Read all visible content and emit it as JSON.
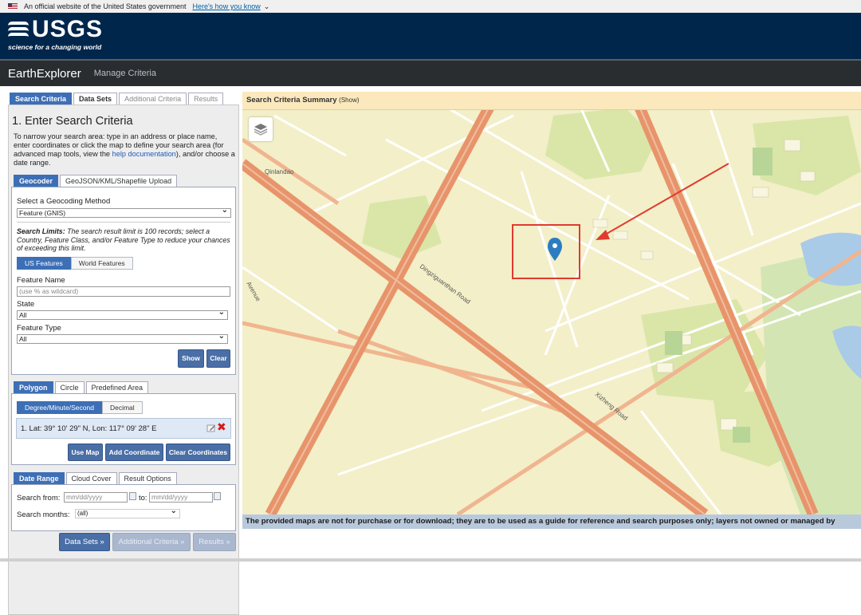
{
  "gov_banner": {
    "text": "An official website of the United States government",
    "link": "Here's how you know"
  },
  "usgs": {
    "word": "USGS",
    "tagline": "science for a changing world"
  },
  "nav": {
    "brand": "EarthExplorer",
    "manage": "Manage Criteria"
  },
  "main_tabs": [
    "Search Criteria",
    "Data Sets",
    "Additional Criteria",
    "Results"
  ],
  "criteria": {
    "title": "1. Enter Search Criteria",
    "intro_1": "To narrow your search area: type in an address or place name, enter coordinates or click the map to define your search area (for advanced map tools, view the ",
    "intro_link": "help documentation",
    "intro_2": "), and/or choose a date range."
  },
  "geocoder_tabs": [
    "Geocoder",
    "GeoJSON/KML/Shapefile Upload"
  ],
  "geocoder": {
    "method_label": "Select a Geocoding Method",
    "method_value": "Feature (GNIS)",
    "limits_bold": "Search Limits:",
    "limits_text": " The search result limit is 100 records; select a Country, Feature Class, and/or Feature Type to reduce your chances of exceeding this limit.",
    "feature_toggle": [
      "US Features",
      "World Features"
    ],
    "feature_name_label": "Feature Name",
    "feature_name_placeholder": "(use % as wildcard)",
    "state_label": "State",
    "state_value": "All",
    "feature_type_label": "Feature Type",
    "feature_type_value": "All",
    "show": "Show",
    "clear": "Clear"
  },
  "area_tabs": [
    "Polygon",
    "Circle",
    "Predefined Area"
  ],
  "area": {
    "format_toggle": [
      "Degree/Minute/Second",
      "Decimal"
    ],
    "coordinate": "1.  Lat: 39° 10' 29\" N, Lon: 117° 09' 28\" E",
    "use_map": "Use Map",
    "add_coordinate": "Add Coordinate",
    "clear_coordinates": "Clear Coordinates"
  },
  "date_tabs": [
    "Date Range",
    "Cloud Cover",
    "Result Options"
  ],
  "date": {
    "from_label": "Search from:",
    "from_placeholder": "mm/dd/yyyy",
    "to_label": "to:",
    "to_placeholder": "mm/dd/yyyy",
    "months_label": "Search months:",
    "months_value": "(all)"
  },
  "footer_buttons": [
    "Data Sets »",
    "Additional Criteria »",
    "Results »"
  ],
  "map": {
    "summary_title": "Search Criteria Summary",
    "summary_show": "(Show)",
    "disclaimer": "The provided maps are not for purchase or for download; they are to be used as a guide for reference and search purposes only; layers not owned or managed by",
    "road_labels": [
      "Qinlandao",
      "Dingziguanthan Road",
      "Xizheng Road",
      "Avenue"
    ],
    "colors": {
      "road_major": "#e8946b",
      "road_minor": "#ffffff",
      "park": "#d9e6a8",
      "water": "#a9cbe8",
      "highlight": "#e03a2f",
      "marker": "#2a7dc0"
    }
  }
}
